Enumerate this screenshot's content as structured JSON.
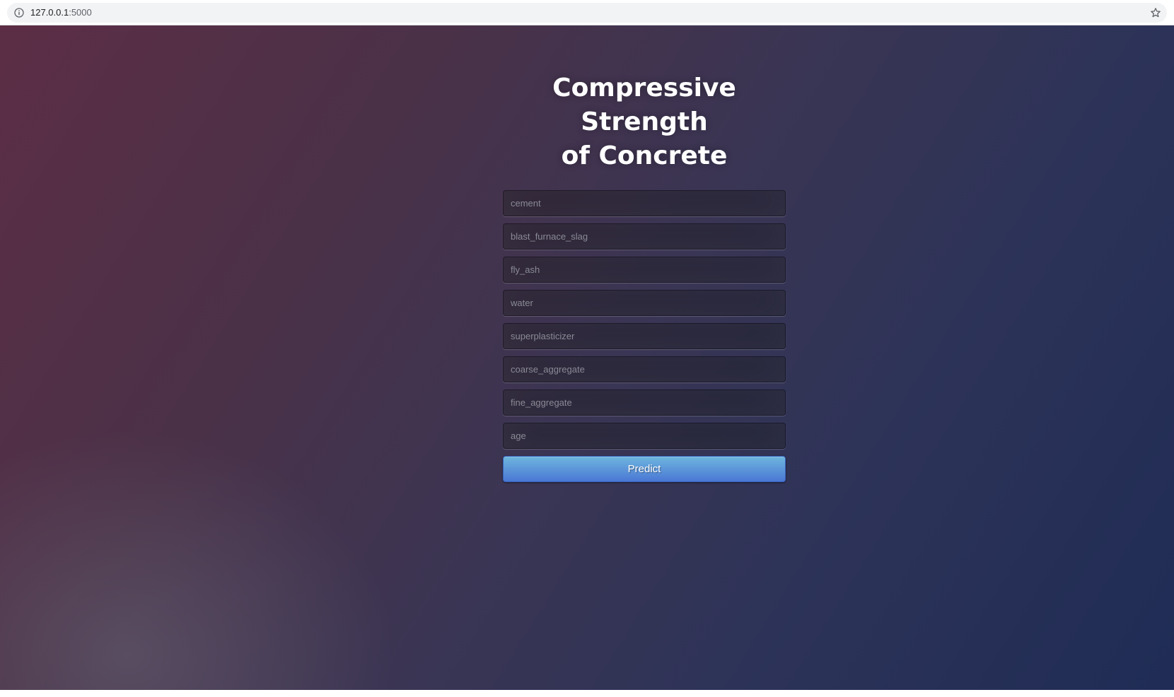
{
  "browser": {
    "url_host": "127.0.0.1",
    "url_port": ":5000",
    "icons": [
      "info-icon",
      "star-icon"
    ]
  },
  "page": {
    "title_line1": "Compressive Strength",
    "title_line2": "of Concrete"
  },
  "form": {
    "fields": [
      {
        "name": "cement",
        "placeholder": "cement",
        "value": ""
      },
      {
        "name": "blast_furnace_slag",
        "placeholder": "blast_furnace_slag",
        "value": ""
      },
      {
        "name": "fly_ash",
        "placeholder": "fly_ash",
        "value": ""
      },
      {
        "name": "water",
        "placeholder": "water",
        "value": ""
      },
      {
        "name": "superplasticizer",
        "placeholder": "superplasticizer",
        "value": ""
      },
      {
        "name": "coarse_aggregate",
        "placeholder": "coarse_aggregate",
        "value": ""
      },
      {
        "name": "fine_aggregate",
        "placeholder": "fine_aggregate",
        "value": ""
      },
      {
        "name": "age",
        "placeholder": "age",
        "value": ""
      }
    ],
    "submit_label": "Predict"
  },
  "colors": {
    "button_top": "#6eb6de",
    "button_bottom": "#4a77d4",
    "bg_left": "#5c2e45",
    "bg_right": "#1f2c55"
  }
}
